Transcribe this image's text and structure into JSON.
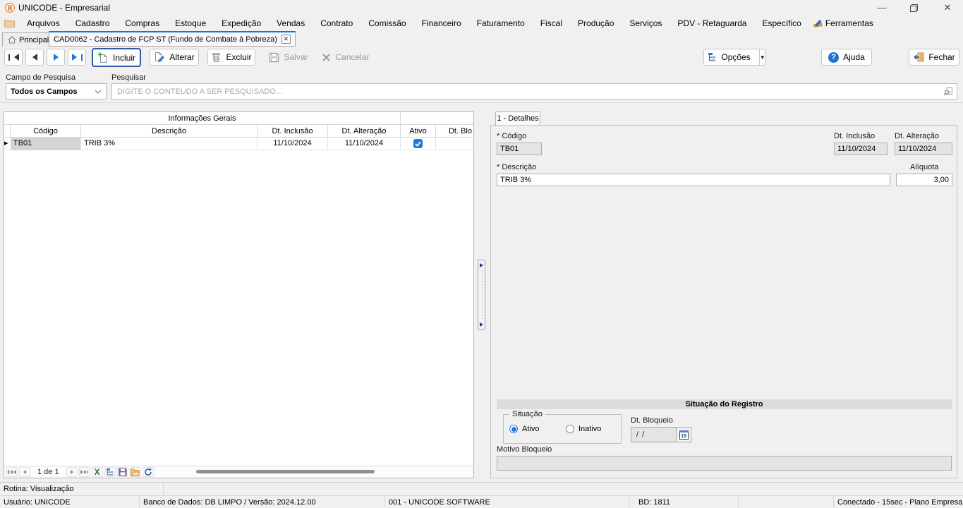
{
  "window": {
    "title": "UNICODE - Empresarial"
  },
  "menu": {
    "items": [
      "Arquivos",
      "Cadastro",
      "Compras",
      "Estoque",
      "Expedição",
      "Vendas",
      "Contrato",
      "Comissão",
      "Financeiro",
      "Faturamento",
      "Fiscal",
      "Produção",
      "Serviços",
      "PDV - Retaguarda",
      "Específico",
      "Ferramentas"
    ]
  },
  "tabs": {
    "home_label": "Principal",
    "active_label": "CAD0062 - Cadastro de FCP ST (Fundo de Combate à Pobreza)"
  },
  "toolbar": {
    "incluir_label": "Incluir",
    "alterar_label": "Alterar",
    "excluir_label": "Excluir",
    "salvar_label": "Salvar",
    "cancelar_label": "Cancelar",
    "opcoes_label": "Opções",
    "ajuda_label": "Ajuda",
    "fechar_label": "Fechar"
  },
  "search": {
    "field_label": "Campo de Pesquisa",
    "field_value": "Todos os Campos",
    "input_label": "Pesquisar",
    "placeholder": "DIGITE O CONTEÚDO A SER PESQUISADO..."
  },
  "grid": {
    "band_title": "Informações Gerais",
    "columns": [
      "Código",
      "Descrição",
      "Dt. Inclusão",
      "Dt. Alteração",
      "Ativo",
      "Dt. Blo"
    ],
    "rows": [
      {
        "codigo": "TB01",
        "descricao": "TRIB 3%",
        "dt_inclusao": "11/10/2024",
        "dt_alteracao": "11/10/2024",
        "ativo": true,
        "dt_bloqueio": ""
      }
    ],
    "pager_label": "1 de 1"
  },
  "detail": {
    "tab_label": "1 - Detalhes",
    "codigo_label": "* Código",
    "codigo_value": "TB01",
    "dt_inclusao_label": "Dt. Inclusão",
    "dt_inclusao_value": "11/10/2024",
    "dt_alteracao_label": "Dt. Alteração",
    "dt_alteracao_value": "11/10/2024",
    "descricao_label": "* Descrição",
    "descricao_value": "TRIB 3%",
    "aliquota_label": "Alíquota",
    "aliquota_value": "3,00",
    "situacao_header": "Situação do Registro",
    "situacao_group_label": "Situação",
    "radio_ativo_label": "Ativo",
    "radio_ativo_selected": true,
    "radio_inativo_label": "Inativo",
    "radio_inativo_selected": false,
    "dt_bloqueio_label": "Dt. Bloqueio",
    "dt_bloqueio_value": "/ /",
    "motivo_bloqueio_label": "Motivo Bloqueio",
    "motivo_bloqueio_value": ""
  },
  "statusbar": {
    "rotina": "Rotina: Visualização",
    "usuario": "Usuário: UNICODE",
    "banco": "Banco de Dados: DB LIMPO / Versão: 2024.12.00",
    "empresa": "001 - UNICODE SOFTWARE",
    "bd": "BD: 1811",
    "conexao": "Conectado - 15sec  -  Plano Empresa"
  },
  "icons": {
    "dropdown_arrow": "▼",
    "tab_close": "✕",
    "help_glyph": "?",
    "minimize": "—",
    "close_window": "✕",
    "excel_glyph": "X"
  },
  "colors": {
    "accent_blue": "#1177d7",
    "focus_border": "#2d5aa0",
    "checkbox_blue": "#1e7ad4",
    "window_bg": "#f0f0f0",
    "excel_green": "#217346",
    "app_orange": "#e87722"
  }
}
